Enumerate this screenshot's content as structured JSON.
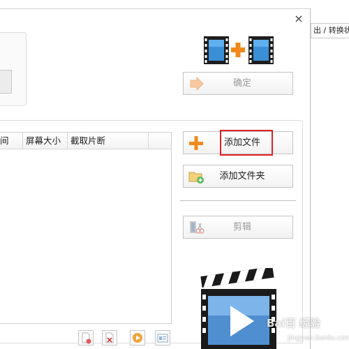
{
  "window": {
    "close_glyph": "×"
  },
  "outside": {
    "tab_text": "出 / 转换状"
  },
  "list": {
    "columns": [
      "间",
      "屏幕大小",
      "截取片断",
      ""
    ]
  },
  "buttons": {
    "confirm": "确定",
    "add_file": "添加文件",
    "add_folder": "添加文件夹",
    "clip": "剪辑"
  },
  "icons": {
    "join_logo": "film-join-icon",
    "confirm": "arrow-right-icon",
    "add_file": "plus-icon",
    "add_folder": "folder-add-icon",
    "clip": "scissors-film-icon",
    "clapper": "clapperboard-play-icon"
  },
  "watermark": {
    "line1": "Bai百 经验",
    "line2": "jingyan.baidu.com"
  },
  "colors": {
    "accent_orange": "#f08a1c",
    "highlight_red": "#e02020",
    "film_blue": "#3a8fd6"
  }
}
